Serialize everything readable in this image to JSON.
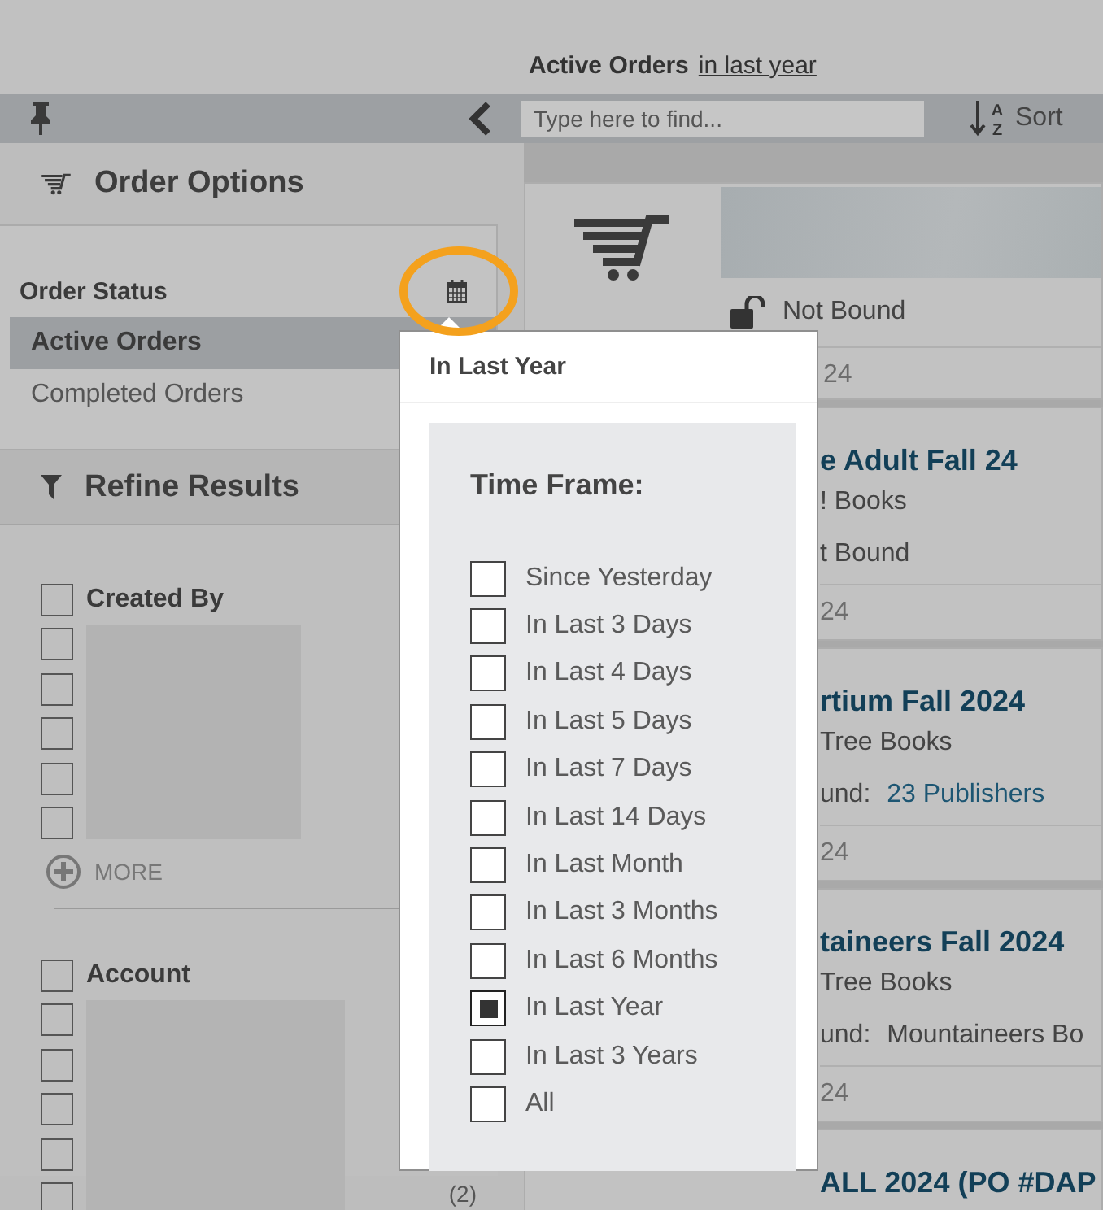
{
  "header": {
    "title": "Active Orders",
    "range_link": "in last year"
  },
  "toolbar": {
    "search": {
      "placeholder": "Type here to find..."
    },
    "sort": {
      "label": "Sort",
      "icon_top": "A",
      "icon_bottom": "Z"
    }
  },
  "order_options": {
    "title": "Order Options",
    "status_heading": "Order Status",
    "statuses": [
      {
        "label": "Active Orders",
        "selected": true
      },
      {
        "label": "Completed Orders",
        "selected": false
      }
    ]
  },
  "refine": {
    "title": "Refine Results",
    "groups": [
      {
        "label": "Created By",
        "checked": false,
        "options": [
          {
            "checked": false
          },
          {
            "checked": false
          },
          {
            "checked": false
          },
          {
            "checked": false
          },
          {
            "checked": false
          }
        ],
        "more": "MORE"
      },
      {
        "label": "Account",
        "checked": false,
        "options": [
          {
            "checked": false
          },
          {
            "checked": false
          },
          {
            "checked": false
          },
          {
            "checked": false
          },
          {
            "checked": false,
            "count": "(2)"
          }
        ]
      }
    ]
  },
  "orders": [
    {
      "kind": "summary",
      "binding": "Not Bound",
      "date": "24"
    },
    {
      "kind": "order",
      "title": "e Adult Fall 24",
      "account": "! Books",
      "binding": "t Bound",
      "date": "24"
    },
    {
      "kind": "order",
      "title": "rtium Fall 2024",
      "account": "Tree Books",
      "binding": "und:",
      "bound_to": {
        "text": "23 Publishers",
        "linked": true
      },
      "date": "24"
    },
    {
      "kind": "order",
      "title": "taineers Fall 2024",
      "account": "Tree Books",
      "binding": "und:",
      "bound_to": {
        "text": "Mountaineers Bo",
        "linked": false
      },
      "date": "24"
    },
    {
      "kind": "order",
      "title": "ALL 2024 (PO #DAP"
    }
  ],
  "popover": {
    "title": "In Last Year",
    "heading": "Time Frame:",
    "options": [
      {
        "label": "Since Yesterday",
        "selected": false
      },
      {
        "label": "In Last 3 Days",
        "selected": false
      },
      {
        "label": "In Last 4 Days",
        "selected": false
      },
      {
        "label": "In Last 5 Days",
        "selected": false
      },
      {
        "label": "In Last 7 Days",
        "selected": false
      },
      {
        "label": "In Last 14 Days",
        "selected": false
      },
      {
        "label": "In Last Month",
        "selected": false
      },
      {
        "label": "In Last 3 Months",
        "selected": false
      },
      {
        "label": "In Last 6 Months",
        "selected": false
      },
      {
        "label": "In Last Year",
        "selected": true
      },
      {
        "label": "In Last 3 Years",
        "selected": false
      },
      {
        "label": "All",
        "selected": false
      }
    ]
  }
}
